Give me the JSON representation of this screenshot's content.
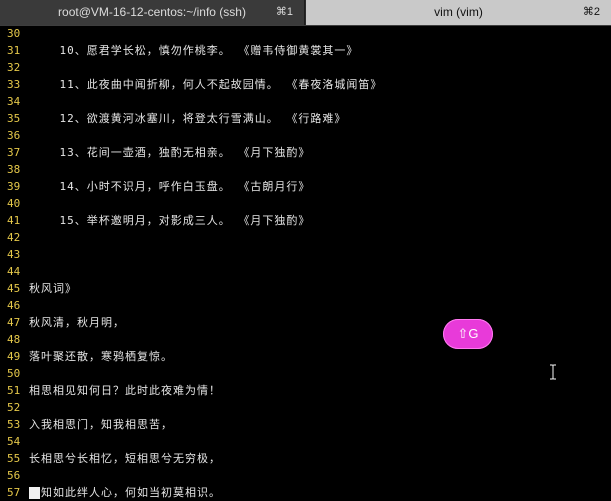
{
  "tabs": [
    {
      "title": "root@VM-16-12-centos:~/info (ssh)",
      "shortcut": "⌘1"
    },
    {
      "title": "vim (vim)",
      "shortcut": "⌘2"
    }
  ],
  "editor": {
    "lines": [
      {
        "num": "30",
        "text": ""
      },
      {
        "num": "31",
        "text": "    10、愿君学长松，慎勿作桃李。 《赠韦侍御黄裳其一》"
      },
      {
        "num": "32",
        "text": ""
      },
      {
        "num": "33",
        "text": "    11、此夜曲中闻折柳，何人不起故园情。 《春夜洛城闻笛》"
      },
      {
        "num": "34",
        "text": ""
      },
      {
        "num": "35",
        "text": "    12、欲渡黄河冰塞川，将登太行雪满山。 《行路难》"
      },
      {
        "num": "36",
        "text": ""
      },
      {
        "num": "37",
        "text": "    13、花间一壶酒，独酌无相亲。 《月下独酌》"
      },
      {
        "num": "38",
        "text": ""
      },
      {
        "num": "39",
        "text": "    14、小时不识月，呼作白玉盘。 《古朗月行》"
      },
      {
        "num": "40",
        "text": ""
      },
      {
        "num": "41",
        "text": "    15、举杯邀明月，对影成三人。 《月下独酌》"
      },
      {
        "num": "42",
        "text": ""
      },
      {
        "num": "43",
        "text": ""
      },
      {
        "num": "44",
        "text": ""
      },
      {
        "num": "45",
        "text": "秋风词》"
      },
      {
        "num": "46",
        "text": ""
      },
      {
        "num": "47",
        "text": "秋风清，秋月明，"
      },
      {
        "num": "48",
        "text": ""
      },
      {
        "num": "49",
        "text": "落叶聚还散，寒鸦栖复惊。"
      },
      {
        "num": "50",
        "text": ""
      },
      {
        "num": "51",
        "text": "相思相见知何日？此时此夜难为情！"
      },
      {
        "num": "52",
        "text": ""
      },
      {
        "num": "53",
        "text": "入我相思门，知我相思苦，"
      },
      {
        "num": "54",
        "text": ""
      },
      {
        "num": "55",
        "text": "长相思兮长相忆，短相思兮无穷极，"
      },
      {
        "num": "56",
        "text": ""
      },
      {
        "num": "57",
        "text": "早知如此绊人心，何如当初莫相识。"
      }
    ]
  },
  "overlay": {
    "badge": "⇧G"
  },
  "colors": {
    "line_number": "#e5c84a",
    "badge": "#e83ad9",
    "text": "#e5e5e5",
    "background": "#000000"
  },
  "icons": {
    "mouse_cursor": "text-cursor-icon"
  }
}
